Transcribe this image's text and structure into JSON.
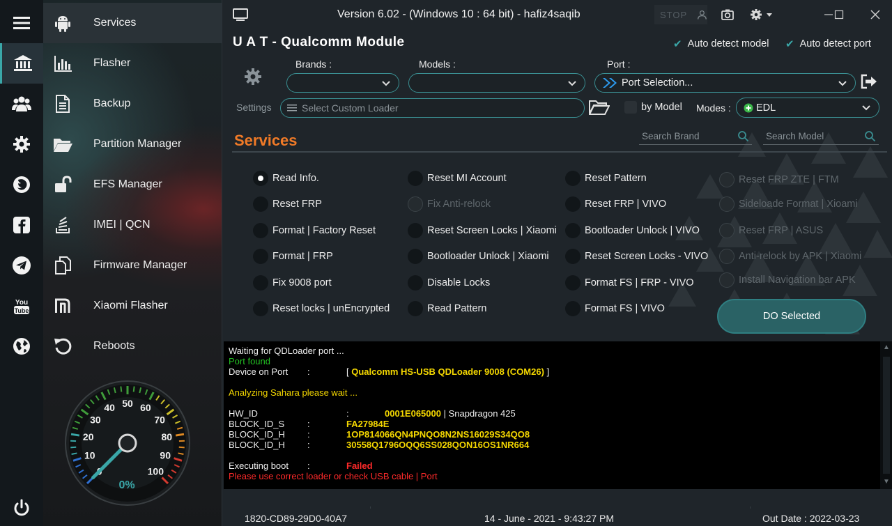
{
  "window": {
    "version_title": "Version 6.02  -  (Windows 10  : 64 bit) - hafiz4saqib",
    "stop_label": "STOP"
  },
  "sidebar": {
    "menu": [
      {
        "label": "Services",
        "icon": "android-icon"
      },
      {
        "label": "Flasher",
        "icon": "bar-chart-icon"
      },
      {
        "label": "Backup",
        "icon": "document-icon"
      },
      {
        "label": "Partition Manager",
        "icon": "folder-open-icon"
      },
      {
        "label": "EFS Manager",
        "icon": "unlock-icon"
      },
      {
        "label": "IMEI  | QCN",
        "icon": "stack-icon"
      },
      {
        "label": "Firmware Manager",
        "icon": "copy-icon"
      },
      {
        "label": "Xiaomi Flasher",
        "icon": "mi-logo-icon"
      },
      {
        "label": "Reboots",
        "icon": "reboot-icon"
      }
    ],
    "rail": [
      "menu-icon",
      "bank-icon",
      "users-icon",
      "gear-icon",
      "firefox-icon",
      "facebook-icon",
      "telegram-icon",
      "youtube-icon",
      "globe-icon",
      "power-icon"
    ]
  },
  "gauge": {
    "ticks": [
      "0",
      "10",
      "20",
      "30",
      "40",
      "50",
      "60",
      "70",
      "80",
      "90",
      "100"
    ],
    "value_text": "0%",
    "value": 0
  },
  "module": {
    "title": "U A T  - Qualcomm Module",
    "auto_detect_model": "Auto detect model",
    "auto_detect_port": "Auto detect port",
    "settings_label": "Settings",
    "brands_label": "Brands :",
    "models_label": "Models :",
    "port_label": "Port :",
    "port_value": "Port Selection...",
    "loader_placeholder": "Select Custom Loader",
    "by_model": "by Model",
    "modes_label": "Modes :",
    "mode_value": "EDL"
  },
  "services": {
    "title": "Services",
    "search_brand": "Search Brand",
    "search_model": "Search Model",
    "col1": [
      "Read Info.",
      "Reset FRP",
      "Format | Factory Reset",
      "Format | FRP",
      "Fix 9008 port",
      "Reset locks | unEncrypted"
    ],
    "col2": [
      "Reset MI Account",
      "Fix Anti-relock",
      "Reset Screen Locks | Xiaomi",
      "Bootloader Unlock | Xiaomi",
      "Disable Locks",
      "Read Pattern"
    ],
    "col3": [
      "Reset Pattern",
      "Reset FRP | VIVO",
      "Bootloader Unlock | VIVO",
      "Reset Screen Locks - VIVO",
      "Format FS | FRP - VIVO",
      "Format FS |  VIVO"
    ],
    "col4": [
      "Reset FRP ZTE | FTM",
      "Sideloade Format | Xioami",
      "Reset FRP | ASUS",
      "Anti-relock by APK | Xiaomi",
      "Install Navigation bar APK"
    ],
    "do_selected": "DO Selected"
  },
  "console": {
    "line1": "Waiting for QDLoader port ...",
    "line2": "Port found",
    "device_key": "Device on Port",
    "device_colon": ":",
    "device_open": "[",
    "device_value": "Qualcomm HS-USB QDLoader 9008 (COM26)",
    "device_close": "]",
    "analyzing": "Analyzing Sahara please wait ...",
    "hwid_key": "HW_ID",
    "hwid_colon": ":",
    "hwid_value": "0001E065000",
    "hwid_extra": "| Snapdragon 425",
    "bids_key": "BLOCK_ID_S",
    "bids_colon": ":",
    "bids_value": "FA27984E",
    "bidh1_key": "BLOCK_ID_H",
    "bidh1_colon": ":",
    "bidh1_value": "1OP814066QN4PNQO8N2NS16029S34QO8",
    "bidh2_key": "BLOCK_ID_H",
    "bidh2_colon": ":",
    "bidh2_value": "30558Q1796OQQ6SS028QON16OS1NR664",
    "boot_key": "Executing boot",
    "boot_colon": ":",
    "boot_value": "Failed",
    "error_line": "Please use correct loader or check USB cable | Port"
  },
  "status": {
    "device_id": "1820-CD89-29D0-40A7",
    "datetime": "14 - June - 2021   -  9:43:27 PM",
    "out_date": "Out Date : 2022-03-23"
  },
  "colors": {
    "accent_teal": "#3aa7a8",
    "services_orange": "#f07a27",
    "console_green": "#22c022",
    "console_yellow": "#f5d800",
    "console_red": "#ff2a2a"
  }
}
